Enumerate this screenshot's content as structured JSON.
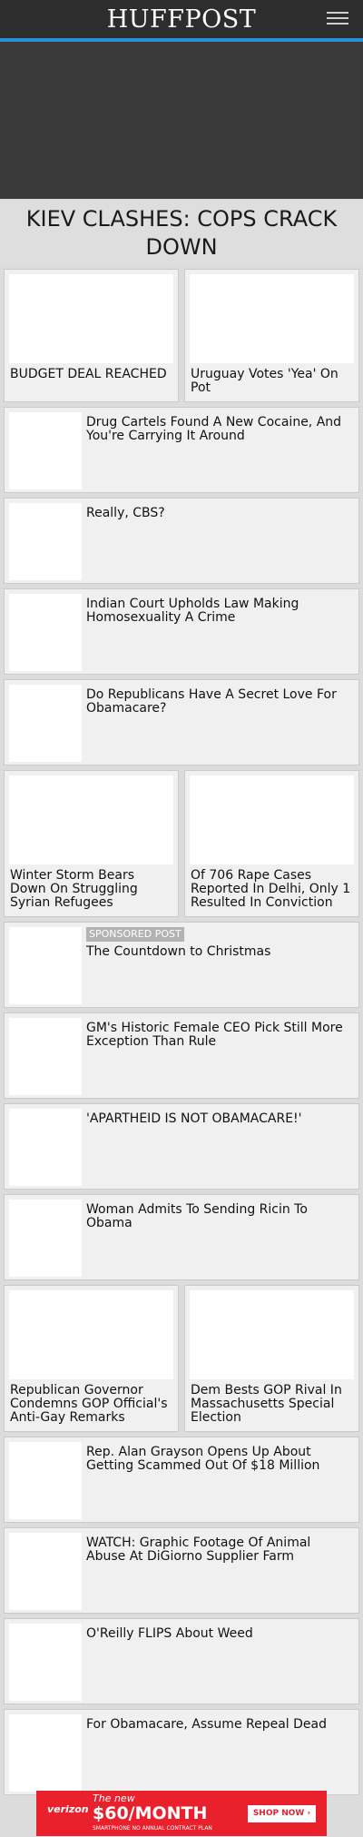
{
  "header": {
    "logo": "HUFFPOST",
    "menu_icon": "hamburger-menu-icon"
  },
  "top_headline": "KIEV CLASHES: COPS CRACK DOWN",
  "stories": {
    "budget": "BUDGET DEAL REACHED",
    "uruguay": "Uruguay Votes 'Yea' On Pot",
    "cartels": "Drug Cartels Found A New Cocaine, And You're Carrying It Around",
    "cbs": "Really, CBS?",
    "indian": "Indian Court Upholds Law Making Homosexuality A Crime",
    "obamacare_love": "Do Republicans Have A Secret Love For Obamacare?",
    "winter": "Winter Storm Bears Down On Struggling Syrian Refugees",
    "rape": "Of 706 Rape Cases Reported In Delhi, Only 1 Resulted In Conviction",
    "sponsored_label": "SPONSORED POST",
    "countdown": "The Countdown to Christmas",
    "gm": "GM's Historic Female CEO Pick Still More Exception Than Rule",
    "apartheid": "'APARTHEID IS NOT OBAMACARE!'",
    "ricin": "Woman Admits To Sending Ricin To Obama",
    "governor": "Republican Governor Condemns GOP Official's Anti-Gay Remarks",
    "dem": "Dem Bests GOP Rival In Massachusetts Special Election",
    "grayson": "Rep. Alan Grayson Opens Up About Getting Scammed Out Of $18 Million",
    "watch": "WATCH: Graphic Footage Of Animal Abuse At DiGiorno Supplier Farm",
    "oreilly": "O'Reilly FLIPS About Weed",
    "repeal": "For Obamacare, Assume Repeal Dead"
  },
  "ad": {
    "brand": "verizon",
    "brand_sub": "",
    "line1": "The new",
    "price": "$60/MONTH",
    "fine": "SMARTPHONE  NO ANNUAL CONTRACT PLAN",
    "cta": "SHOP NOW"
  },
  "colors": {
    "header_bg": "#2d2d2d",
    "accent_blue": "#2a8fd6",
    "ad_red": "#e8212d"
  }
}
